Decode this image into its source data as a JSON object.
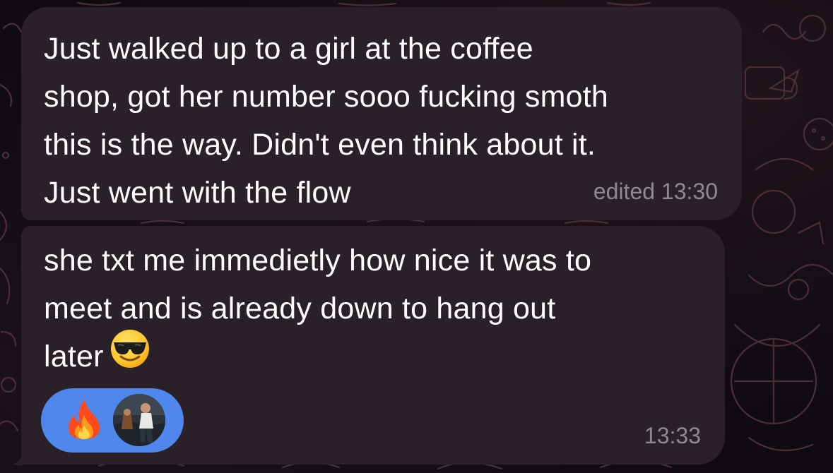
{
  "messages": [
    {
      "text": "Just walked up to a girl at the coffee\nshop, got her number sooo fucking smoth\nthis is the way. Didn't even think about it.\nJust went with the flow",
      "status": "edited 13:30"
    },
    {
      "text": "she txt me immedietly how nice it was to\nmeet and is already down to hang out\nlater",
      "emoji": "smiling-face-with-sunglasses",
      "time": "13:33",
      "reaction": {
        "emoji": "fire-icon",
        "reactor": "avatar"
      }
    }
  ],
  "colors": {
    "bubble": "#2a2128",
    "background": "#0f0b11",
    "text": "#ffffff",
    "meta": "#8e8a92",
    "reaction": "#4f87ec"
  }
}
